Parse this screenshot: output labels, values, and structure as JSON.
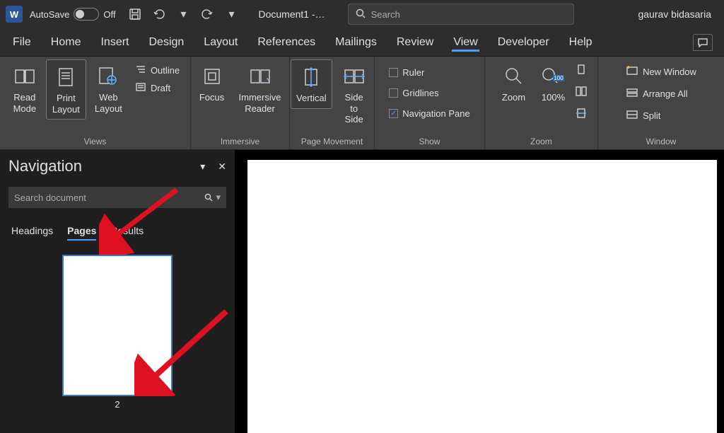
{
  "titlebar": {
    "autosave_label": "AutoSave",
    "autosave_state": "Off",
    "doc_title": "Document1 -…",
    "search_placeholder": "Search",
    "username": "gaurav bidasaria"
  },
  "menu": {
    "items": [
      "File",
      "Home",
      "Insert",
      "Design",
      "Layout",
      "References",
      "Mailings",
      "Review",
      "View",
      "Developer",
      "Help"
    ],
    "active": "View"
  },
  "ribbon": {
    "views": {
      "label": "Views",
      "read_mode": "Read\nMode",
      "print_layout": "Print\nLayout",
      "web_layout": "Web\nLayout",
      "outline": "Outline",
      "draft": "Draft"
    },
    "immersive": {
      "label": "Immersive",
      "focus": "Focus",
      "reader": "Immersive\nReader"
    },
    "page_movement": {
      "label": "Page Movement",
      "vertical": "Vertical",
      "side": "Side\nto Side"
    },
    "show": {
      "label": "Show",
      "ruler": "Ruler",
      "gridlines": "Gridlines",
      "navpane": "Navigation Pane"
    },
    "zoom": {
      "label": "Zoom",
      "zoom": "Zoom",
      "hundred": "100%"
    },
    "window": {
      "label": "Window",
      "new": "New Window",
      "arrange": "Arrange All",
      "split": "Split"
    }
  },
  "nav": {
    "title": "Navigation",
    "search_placeholder": "Search document",
    "tabs": [
      "Headings",
      "Pages",
      "Results"
    ],
    "active_tab": "Pages",
    "page_number": "2"
  }
}
